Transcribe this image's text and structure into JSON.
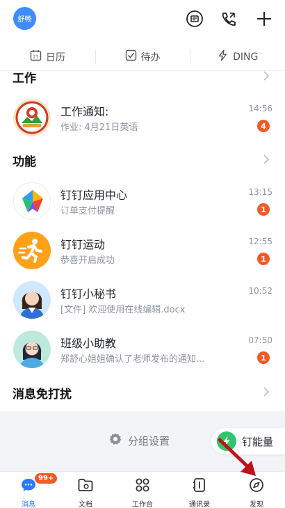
{
  "user": {
    "avatar_text": "舒畅"
  },
  "topbar": {
    "icons": [
      "scan-icon",
      "phone-call-icon",
      "add-icon"
    ]
  },
  "quickbar": {
    "items": [
      {
        "label": "日历",
        "icon": "calendar-icon"
      },
      {
        "label": "待办",
        "icon": "todo-check-icon"
      },
      {
        "label": "DING",
        "icon": "ding-bolt-icon"
      }
    ]
  },
  "sections": {
    "work": {
      "title": "工作"
    },
    "functions": {
      "title": "功能"
    },
    "dnd": {
      "title": "消息免打扰"
    }
  },
  "conversations": [
    {
      "title": "工作通知:",
      "subtitle": "作业: 4月21日英语",
      "time": "14:56",
      "badge": "4"
    },
    {
      "title": "钉钉应用中心",
      "subtitle": "订单支付提醒",
      "time": "13:15",
      "badge": "1"
    },
    {
      "title": "钉钉运动",
      "subtitle": "恭喜开启成功",
      "time": "12:55",
      "badge": "1"
    },
    {
      "title": "钉钉小秘书",
      "subtitle": "[文件] 欢迎使用在线编辑.docx",
      "time": "10:52",
      "badge": ""
    },
    {
      "title": "班级小助教",
      "subtitle": "郑舒心姐姐确认了老师发布的通知...",
      "time": "07:50",
      "badge": "1"
    }
  ],
  "footer": {
    "group_setting_label": "分组设置",
    "ding_energy_label": "钉能量"
  },
  "tabs": [
    {
      "label": "消息",
      "icon": "message-icon",
      "badge": "99+",
      "active": true
    },
    {
      "label": "文档",
      "icon": "folder-icon",
      "badge": "",
      "active": false
    },
    {
      "label": "工作台",
      "icon": "workbench-icon",
      "badge": "",
      "active": false
    },
    {
      "label": "通讯录",
      "icon": "contacts-icon",
      "badge": "",
      "active": false
    },
    {
      "label": "发现",
      "icon": "discover-icon",
      "badge": "",
      "active": false
    }
  ],
  "colors": {
    "accent": "#2a7cff",
    "badge": "#f15a24",
    "ding_green": "#2ec76b",
    "annotation_arrow": "#c0121b"
  }
}
